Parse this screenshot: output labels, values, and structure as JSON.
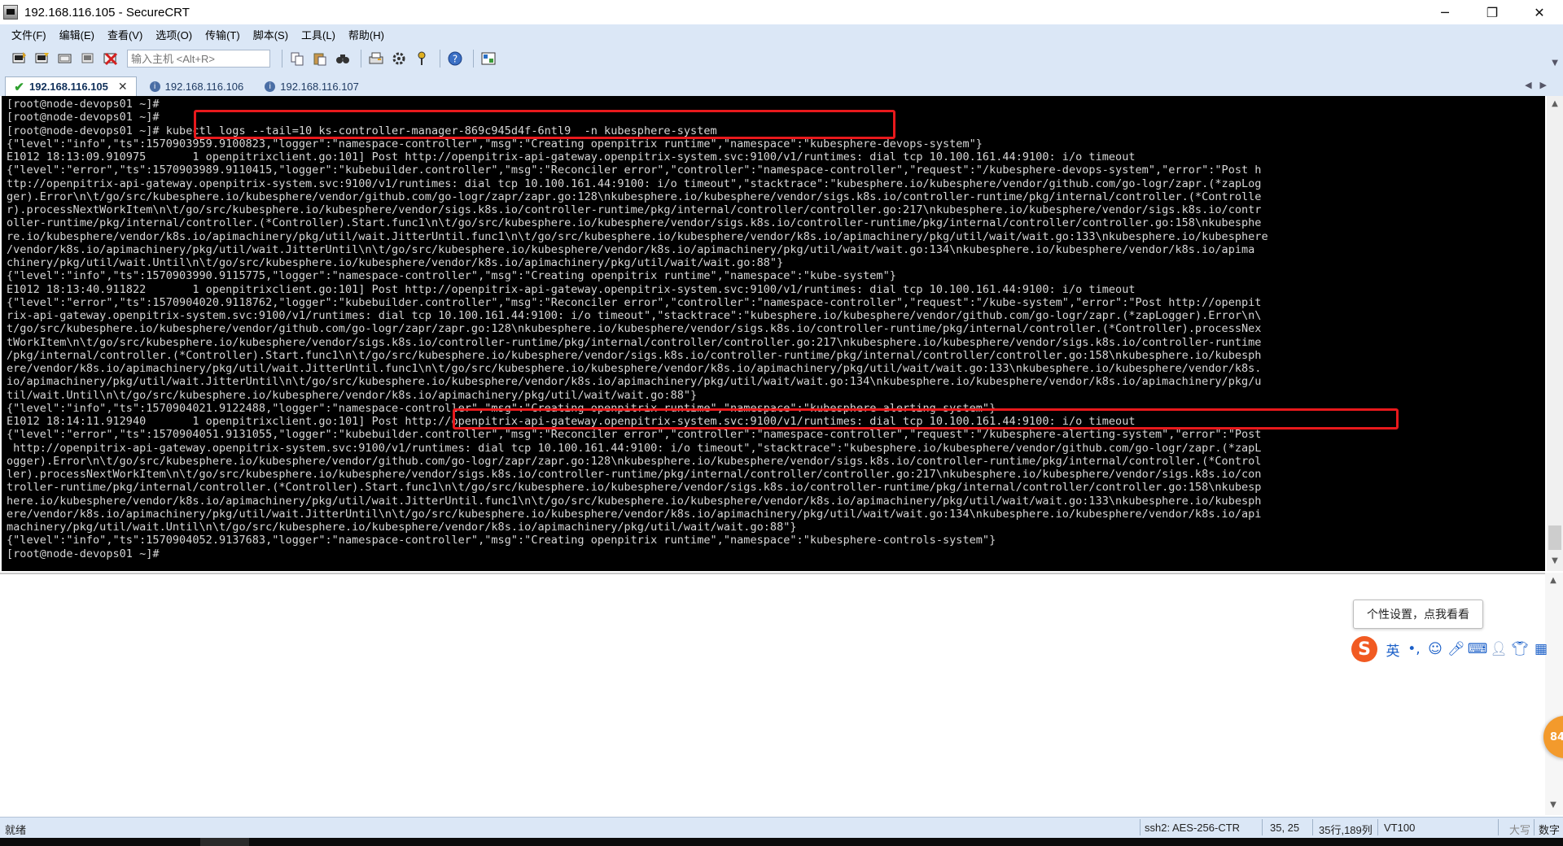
{
  "window": {
    "title": "192.168.116.105 - SecureCRT",
    "icon": "securecrt-app-icon",
    "controls": {
      "minimize": "─",
      "restore": "❐",
      "close": "✕"
    }
  },
  "menu": [
    "文件(F)",
    "编辑(E)",
    "查看(V)",
    "选项(O)",
    "传输(T)",
    "脚本(S)",
    "工具(L)",
    "帮助(H)"
  ],
  "toolbar": {
    "host_placeholder": "输入主机 <Alt+R>",
    "icons": [
      "connect-icon",
      "quick-connect-icon",
      "connect-tab-icon",
      "reconnect-icon",
      "disconnect-icon",
      "copy-icon",
      "paste-icon",
      "find-icon",
      "print-icon",
      "settings-icon",
      "keymap-icon",
      "help-icon",
      "sftp-icon"
    ]
  },
  "tabs": [
    {
      "label": "192.168.116.105",
      "active": true,
      "status": "connected"
    },
    {
      "label": "192.168.116.106",
      "active": false,
      "status": "info"
    },
    {
      "label": "192.168.116.107",
      "active": false,
      "status": "info"
    }
  ],
  "terminal": {
    "fg_color": "#d6d6d6",
    "bg_color": "#000000",
    "highlight_color": "#e8191c",
    "lines": [
      "[root@node-devops01 ~]#",
      "[root@node-devops01 ~]#",
      "[root@node-devops01 ~]# kubectl logs --tail=10 ks-controller-manager-869c945d4f-6ntl9  -n kubesphere-system",
      "{\"level\":\"info\",\"ts\":1570903959.9100823,\"logger\":\"namespace-controller\",\"msg\":\"Creating openpitrix runtime\",\"namespace\":\"kubesphere-devops-system\"}",
      "E1012 18:13:09.910975       1 openpitrixclient.go:101] Post http://openpitrix-api-gateway.openpitrix-system.svc:9100/v1/runtimes: dial tcp 10.100.161.44:9100: i/o timeout",
      "{\"level\":\"error\",\"ts\":1570903989.9110415,\"logger\":\"kubebuilder.controller\",\"msg\":\"Reconciler error\",\"controller\":\"namespace-controller\",\"request\":\"/kubesphere-devops-system\",\"error\":\"Post h",
      "ttp://openpitrix-api-gateway.openpitrix-system.svc:9100/v1/runtimes: dial tcp 10.100.161.44:9100: i/o timeout\",\"stacktrace\":\"kubesphere.io/kubesphere/vendor/github.com/go-logr/zapr.(*zapLog",
      "ger).Error\\n\\t/go/src/kubesphere.io/kubesphere/vendor/github.com/go-logr/zapr/zapr.go:128\\nkubesphere.io/kubesphere/vendor/sigs.k8s.io/controller-runtime/pkg/internal/controller.(*Controlle",
      "r).processNextWorkItem\\n\\t/go/src/kubesphere.io/kubesphere/vendor/sigs.k8s.io/controller-runtime/pkg/internal/controller/controller.go:217\\nkubesphere.io/kubesphere/vendor/sigs.k8s.io/contr",
      "oller-runtime/pkg/internal/controller.(*Controller).Start.func1\\n\\t/go/src/kubesphere.io/kubesphere/vendor/sigs.k8s.io/controller-runtime/pkg/internal/controller/controller.go:158\\nkubesphe",
      "re.io/kubesphere/vendor/k8s.io/apimachinery/pkg/util/wait.JitterUntil.func1\\n\\t/go/src/kubesphere.io/kubesphere/vendor/k8s.io/apimachinery/pkg/util/wait/wait.go:133\\nkubesphere.io/kubesphere",
      "/vendor/k8s.io/apimachinery/pkg/util/wait.JitterUntil\\n\\t/go/src/kubesphere.io/kubesphere/vendor/k8s.io/apimachinery/pkg/util/wait/wait.go:134\\nkubesphere.io/kubesphere/vendor/k8s.io/apima",
      "chinery/pkg/util/wait.Until\\n\\t/go/src/kubesphere.io/kubesphere/vendor/k8s.io/apimachinery/pkg/util/wait/wait.go:88\"}",
      "{\"level\":\"info\",\"ts\":1570903990.9115775,\"logger\":\"namespace-controller\",\"msg\":\"Creating openpitrix runtime\",\"namespace\":\"kube-system\"}",
      "E1012 18:13:40.911822       1 openpitrixclient.go:101] Post http://openpitrix-api-gateway.openpitrix-system.svc:9100/v1/runtimes: dial tcp 10.100.161.44:9100: i/o timeout",
      "{\"level\":\"error\",\"ts\":1570904020.9118762,\"logger\":\"kubebuilder.controller\",\"msg\":\"Reconciler error\",\"controller\":\"namespace-controller\",\"request\":\"/kube-system\",\"error\":\"Post http://openpit",
      "rix-api-gateway.openpitrix-system.svc:9100/v1/runtimes: dial tcp 10.100.161.44:9100: i/o timeout\",\"stacktrace\":\"kubesphere.io/kubesphere/vendor/github.com/go-logr/zapr.(*zapLogger).Error\\n\\",
      "t/go/src/kubesphere.io/kubesphere/vendor/github.com/go-logr/zapr/zapr.go:128\\nkubesphere.io/kubesphere/vendor/sigs.k8s.io/controller-runtime/pkg/internal/controller.(*Controller).processNex",
      "tWorkItem\\n\\t/go/src/kubesphere.io/kubesphere/vendor/sigs.k8s.io/controller-runtime/pkg/internal/controller/controller.go:217\\nkubesphere.io/kubesphere/vendor/sigs.k8s.io/controller-runtime",
      "/pkg/internal/controller.(*Controller).Start.func1\\n\\t/go/src/kubesphere.io/kubesphere/vendor/sigs.k8s.io/controller-runtime/pkg/internal/controller/controller.go:158\\nkubesphere.io/kubesph",
      "ere/vendor/k8s.io/apimachinery/pkg/util/wait.JitterUntil.func1\\n\\t/go/src/kubesphere.io/kubesphere/vendor/k8s.io/apimachinery/pkg/util/wait/wait.go:133\\nkubesphere.io/kubesphere/vendor/k8s.",
      "io/apimachinery/pkg/util/wait.JitterUntil\\n\\t/go/src/kubesphere.io/kubesphere/vendor/k8s.io/apimachinery/pkg/util/wait/wait.go:134\\nkubesphere.io/kubesphere/vendor/k8s.io/apimachinery/pkg/u",
      "til/wait.Until\\n\\t/go/src/kubesphere.io/kubesphere/vendor/k8s.io/apimachinery/pkg/util/wait/wait.go:88\"}",
      "{\"level\":\"info\",\"ts\":1570904021.9122488,\"logger\":\"namespace-controller\",\"msg\":\"Creating openpitrix runtime\",\"namespace\":\"kubesphere-alerting-system\"}",
      "E1012 18:14:11.912940       1 openpitrixclient.go:101] Post http://openpitrix-api-gateway.openpitrix-system.svc:9100/v1/runtimes: dial tcp 10.100.161.44:9100: i/o timeout",
      "{\"level\":\"error\",\"ts\":1570904051.9131055,\"logger\":\"kubebuilder.controller\",\"msg\":\"Reconciler error\",\"controller\":\"namespace-controller\",\"request\":\"/kubesphere-alerting-system\",\"error\":\"Post",
      " http://openpitrix-api-gateway.openpitrix-system.svc:9100/v1/runtimes: dial tcp 10.100.161.44:9100: i/o timeout\",\"stacktrace\":\"kubesphere.io/kubesphere/vendor/github.com/go-logr/zapr.(*zapL",
      "ogger).Error\\n\\t/go/src/kubesphere.io/kubesphere/vendor/github.com/go-logr/zapr/zapr.go:128\\nkubesphere.io/kubesphere/vendor/sigs.k8s.io/controller-runtime/pkg/internal/controller.(*Control",
      "ler).processNextWorkItem\\n\\t/go/src/kubesphere.io/kubesphere/vendor/sigs.k8s.io/controller-runtime/pkg/internal/controller/controller.go:217\\nkubesphere.io/kubesphere/vendor/sigs.k8s.io/con",
      "troller-runtime/pkg/internal/controller.(*Controller).Start.func1\\n\\t/go/src/kubesphere.io/kubesphere/vendor/sigs.k8s.io/controller-runtime/pkg/internal/controller/controller.go:158\\nkubesp",
      "here.io/kubesphere/vendor/k8s.io/apimachinery/pkg/util/wait.JitterUntil.func1\\n\\t/go/src/kubesphere.io/kubesphere/vendor/k8s.io/apimachinery/pkg/util/wait/wait.go:133\\nkubesphere.io/kubesph",
      "ere/vendor/k8s.io/apimachinery/pkg/util/wait.JitterUntil\\n\\t/go/src/kubesphere.io/kubesphere/vendor/k8s.io/apimachinery/pkg/util/wait/wait.go:134\\nkubesphere.io/kubesphere/vendor/k8s.io/api",
      "machinery/pkg/util/wait.Until\\n\\t/go/src/kubesphere.io/kubesphere/vendor/k8s.io/apimachinery/pkg/util/wait/wait.go:88\"}",
      "{\"level\":\"info\",\"ts\":1570904052.9137683,\"logger\":\"namespace-controller\",\"msg\":\"Creating openpitrix runtime\",\"namespace\":\"kubesphere-controls-system\"}",
      "[root@node-devops01 ~]#"
    ]
  },
  "ime": {
    "tooltip": "个性设置，点我看看",
    "logo": "S",
    "lang": "英",
    "punct": "•,",
    "icons": [
      "emoji-icon",
      "voice-icon",
      "keyboard-icon",
      "user-icon",
      "skin-icon",
      "toolbox-icon"
    ]
  },
  "side_badge": "84",
  "status": {
    "ready": "就绪",
    "encryption": "ssh2: AES-256-CTR",
    "cursor": "35,  25",
    "position": "35行,189列",
    "term": "VT100",
    "caps": "大写",
    "num": "数字"
  }
}
